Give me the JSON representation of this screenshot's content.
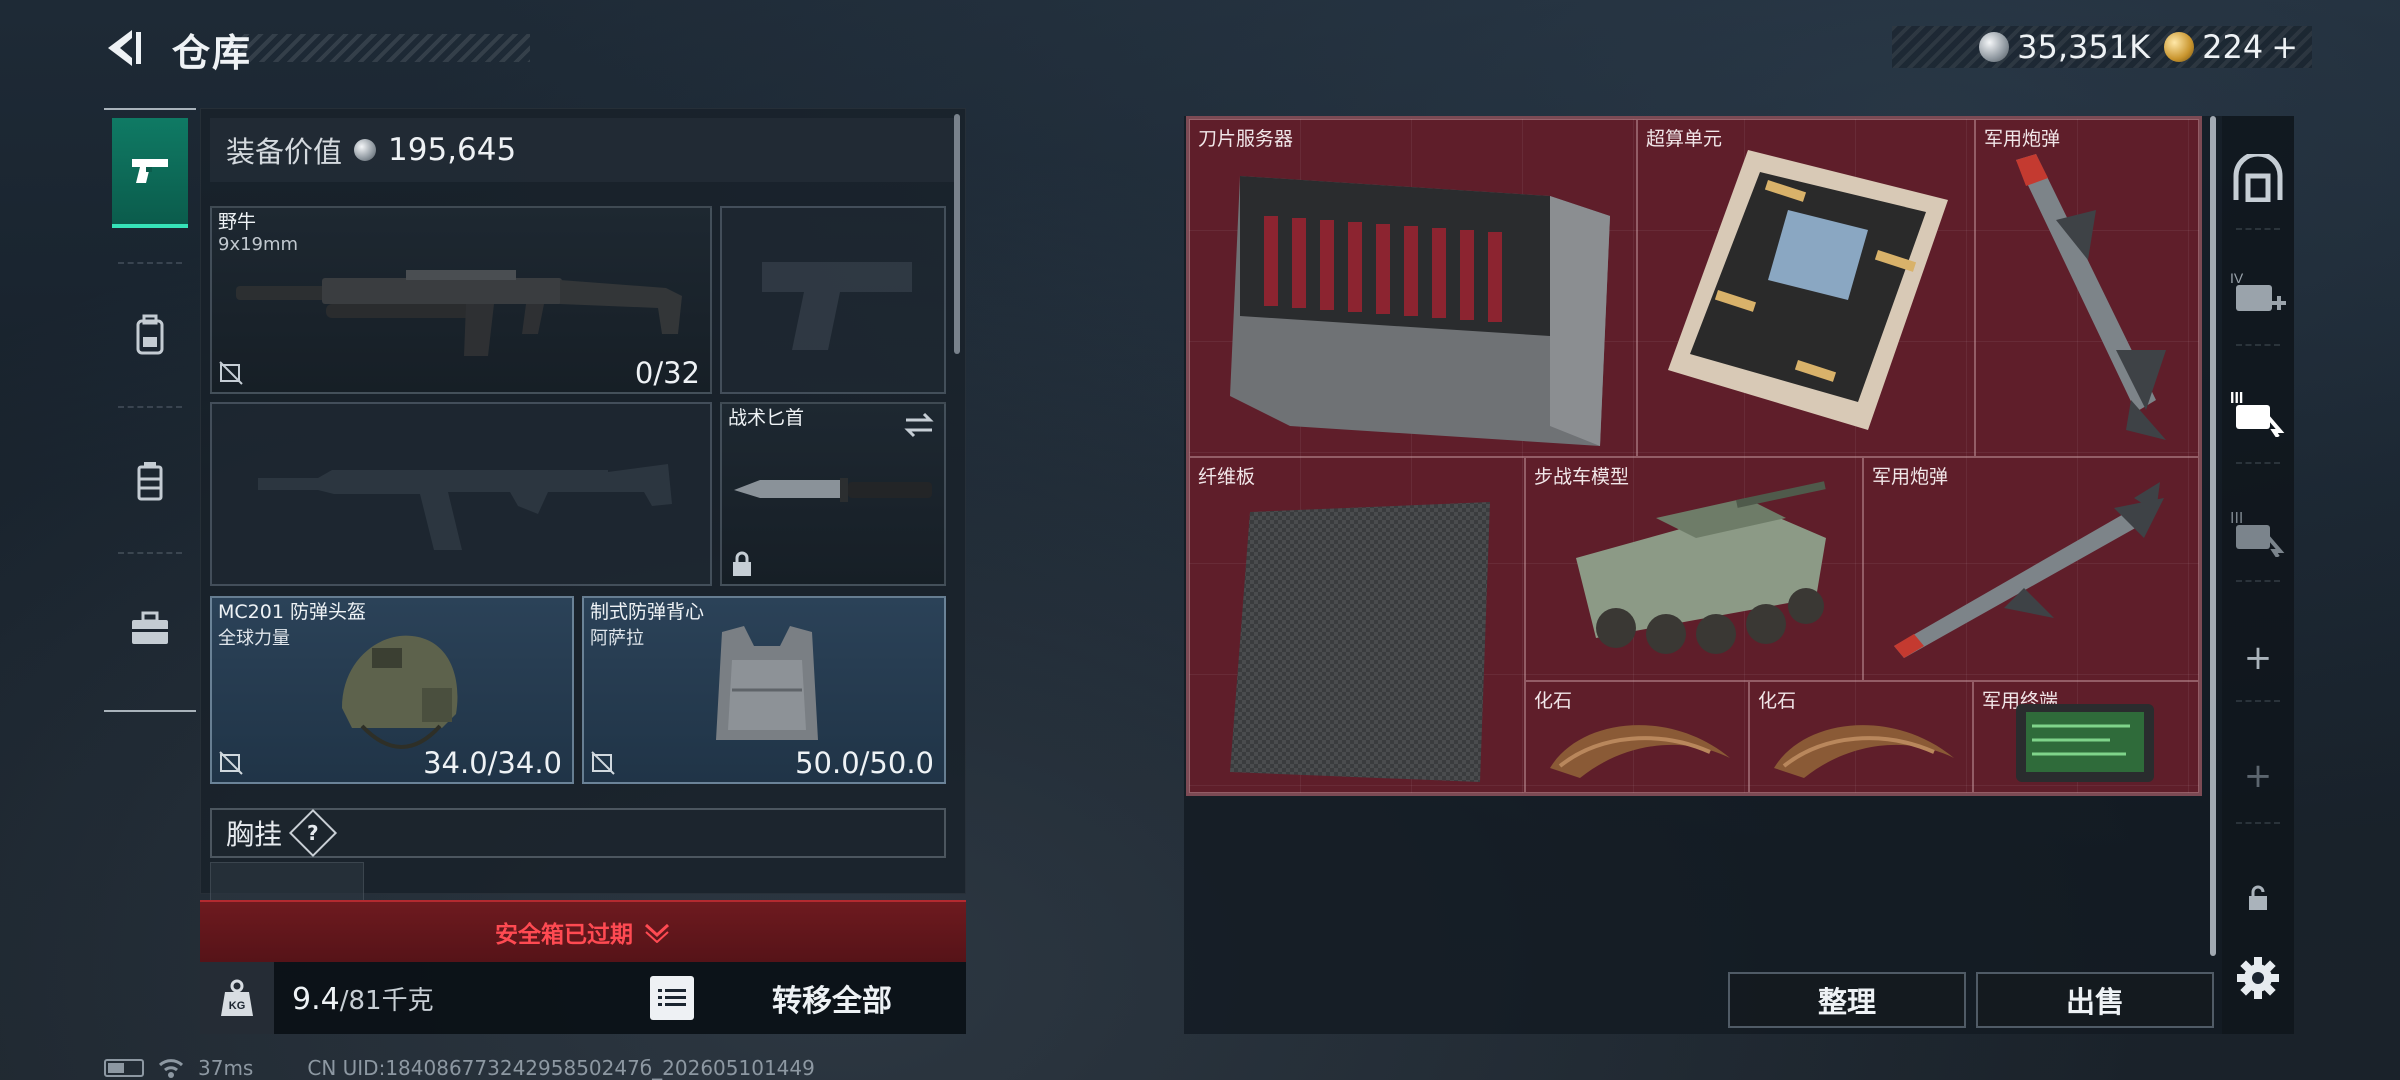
{
  "header": {
    "title": "仓库",
    "currency_silver": "35,351K",
    "currency_gold": "224",
    "gold_add": "+"
  },
  "sidebar": {
    "tabs": [
      {
        "name": "weapons",
        "icon": "pistol-icon",
        "active": true
      },
      {
        "name": "backpack",
        "icon": "backpack-icon",
        "active": false
      },
      {
        "name": "container",
        "icon": "canister-icon",
        "active": false
      },
      {
        "name": "case",
        "icon": "briefcase-icon",
        "active": false
      }
    ]
  },
  "loadout": {
    "equip_value_label": "装备价值",
    "equip_value": "195,645",
    "primary_weapon": {
      "name": "野牛",
      "caliber": "9x19mm",
      "ammo": "0/32"
    },
    "knife": {
      "name": "战术匕首"
    },
    "helmet": {
      "name": "MC201 防弹头盔",
      "brand": "全球力量",
      "durability": "34.0/34.0"
    },
    "vest": {
      "name": "制式防弹背心",
      "brand": "阿萨拉",
      "durability": "50.0/50.0"
    },
    "chest_rig_label": "胸挂",
    "chest_rig_help": "?",
    "safebox_warning": "安全箱已过期",
    "weight_current": "9.4",
    "weight_max": "/81千克",
    "weight_icon_text": "KG",
    "transfer_all": "转移全部"
  },
  "storage": {
    "items": [
      {
        "name": "刀片服务器"
      },
      {
        "name": "超算单元"
      },
      {
        "name": "军用炮弹"
      },
      {
        "name": "纤维板"
      },
      {
        "name": "步战车模型"
      },
      {
        "name": "军用炮弹"
      },
      {
        "name": "化石"
      },
      {
        "name": "化石"
      },
      {
        "name": "军用终端"
      }
    ],
    "sort_button": "整理",
    "sell_button": "出售"
  },
  "right_column": {
    "slot_labels": [
      "IV",
      "III",
      "III"
    ],
    "add": "+",
    "add_disabled": "+"
  },
  "footer": {
    "ping": "37ms",
    "uid": "CN UID:18408677324295850247б_202605101449"
  },
  "colors": {
    "accent_active_tab": "#0f7a64",
    "storage_bg": "#5f1e2a",
    "armor_slot": "#2b4258",
    "warning_red": "#ff4a52"
  }
}
